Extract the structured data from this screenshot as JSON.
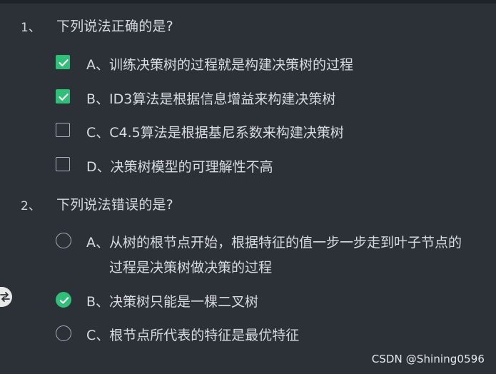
{
  "questions": [
    {
      "number": "1、",
      "text": "下列说法正确的是?",
      "type": "multiple",
      "options": [
        {
          "label": "A、训练决策树的过程就是构建决策树的过程",
          "checked": true
        },
        {
          "label": "B、ID3算法是根据信息增益来构建决策树",
          "checked": true
        },
        {
          "label": "C、C4.5算法是根据基尼系数来构建决策树",
          "checked": false
        },
        {
          "label": "D、决策树模型的可理解性不高",
          "checked": false
        }
      ]
    },
    {
      "number": "2、",
      "text": "下列说法错误的是?",
      "type": "single",
      "options": [
        {
          "label": "A、从树的根节点开始，根据特征的值一步一步走到叶子节点的",
          "label_line2": "过程是决策树做决策的过程",
          "checked": false
        },
        {
          "label": "B、决策树只能是一棵二叉树",
          "checked": true
        },
        {
          "label": "C、根节点所代表的特征是最优特征",
          "checked": false
        }
      ]
    }
  ],
  "watermark": "CSDN @Shining0596",
  "colors": {
    "background": "#2b3137",
    "accent": "#2fbf78",
    "text": "#d7dbe0"
  },
  "icons": {
    "side_tab": "swap-arrows-icon"
  }
}
